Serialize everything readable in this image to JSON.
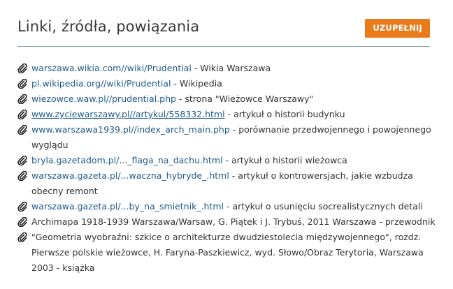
{
  "header": {
    "title": "Linki, źródła, powiązania",
    "button_label": "UZUPEŁNIJ"
  },
  "icons": {
    "item": "paperclip-icon"
  },
  "colors": {
    "link": "#1f5a8a",
    "button": "#ea7a1a",
    "divider": "#8a9cab"
  },
  "links": [
    {
      "link": "warszawa.wikia.com//wiki/Prudential",
      "desc": " - Wikia Warszawa"
    },
    {
      "link": "pl.wikipedia.org//wiki/Prudential",
      "desc": " - Wikipedia"
    },
    {
      "link": "wiezowce.waw.pl//prudential.php",
      "desc": " - strona \"Wieżowce Warszawy\""
    },
    {
      "link": "www.zyciewarszawy.pl//artykul/558332.html",
      "desc": " - artykuł o historii budynku"
    },
    {
      "link": "www.warszawa1939.pl//index_arch_main.php",
      "desc": " - porównanie przedwojennego i powojennego wyglądu"
    },
    {
      "link": "bryla.gazetadom.pl/..._flaga_na_dachu.html",
      "desc": " - artykuł o historii wieżowca"
    },
    {
      "link": "warszawa.gazeta.pl/...waczna_hybryde_.html",
      "desc": " - artykuł o kontrowersjach, jakie wzbudza obecny remont"
    },
    {
      "link": "warszawa.gazeta.pl/...by_na_smietnik_.html",
      "desc": " - artykuł o usunięciu socrealistycznych detali"
    },
    {
      "link": "",
      "desc": "Archimapa 1918-1939 Warszawa/Warsaw, G. Piątek i J. Trybuś, 2011 Warszawa - przewodnik"
    },
    {
      "link": "",
      "desc": "\"Geometria wyobraźni: szkice o architekturze dwudziestolecia międzywojennego\", rozdz. Pierwsze polskie wieżowce, H. Faryna-Paszkiewicz, wyd. Słowo/Obraz Terytoria, Warszawa 2003 - książka"
    }
  ]
}
